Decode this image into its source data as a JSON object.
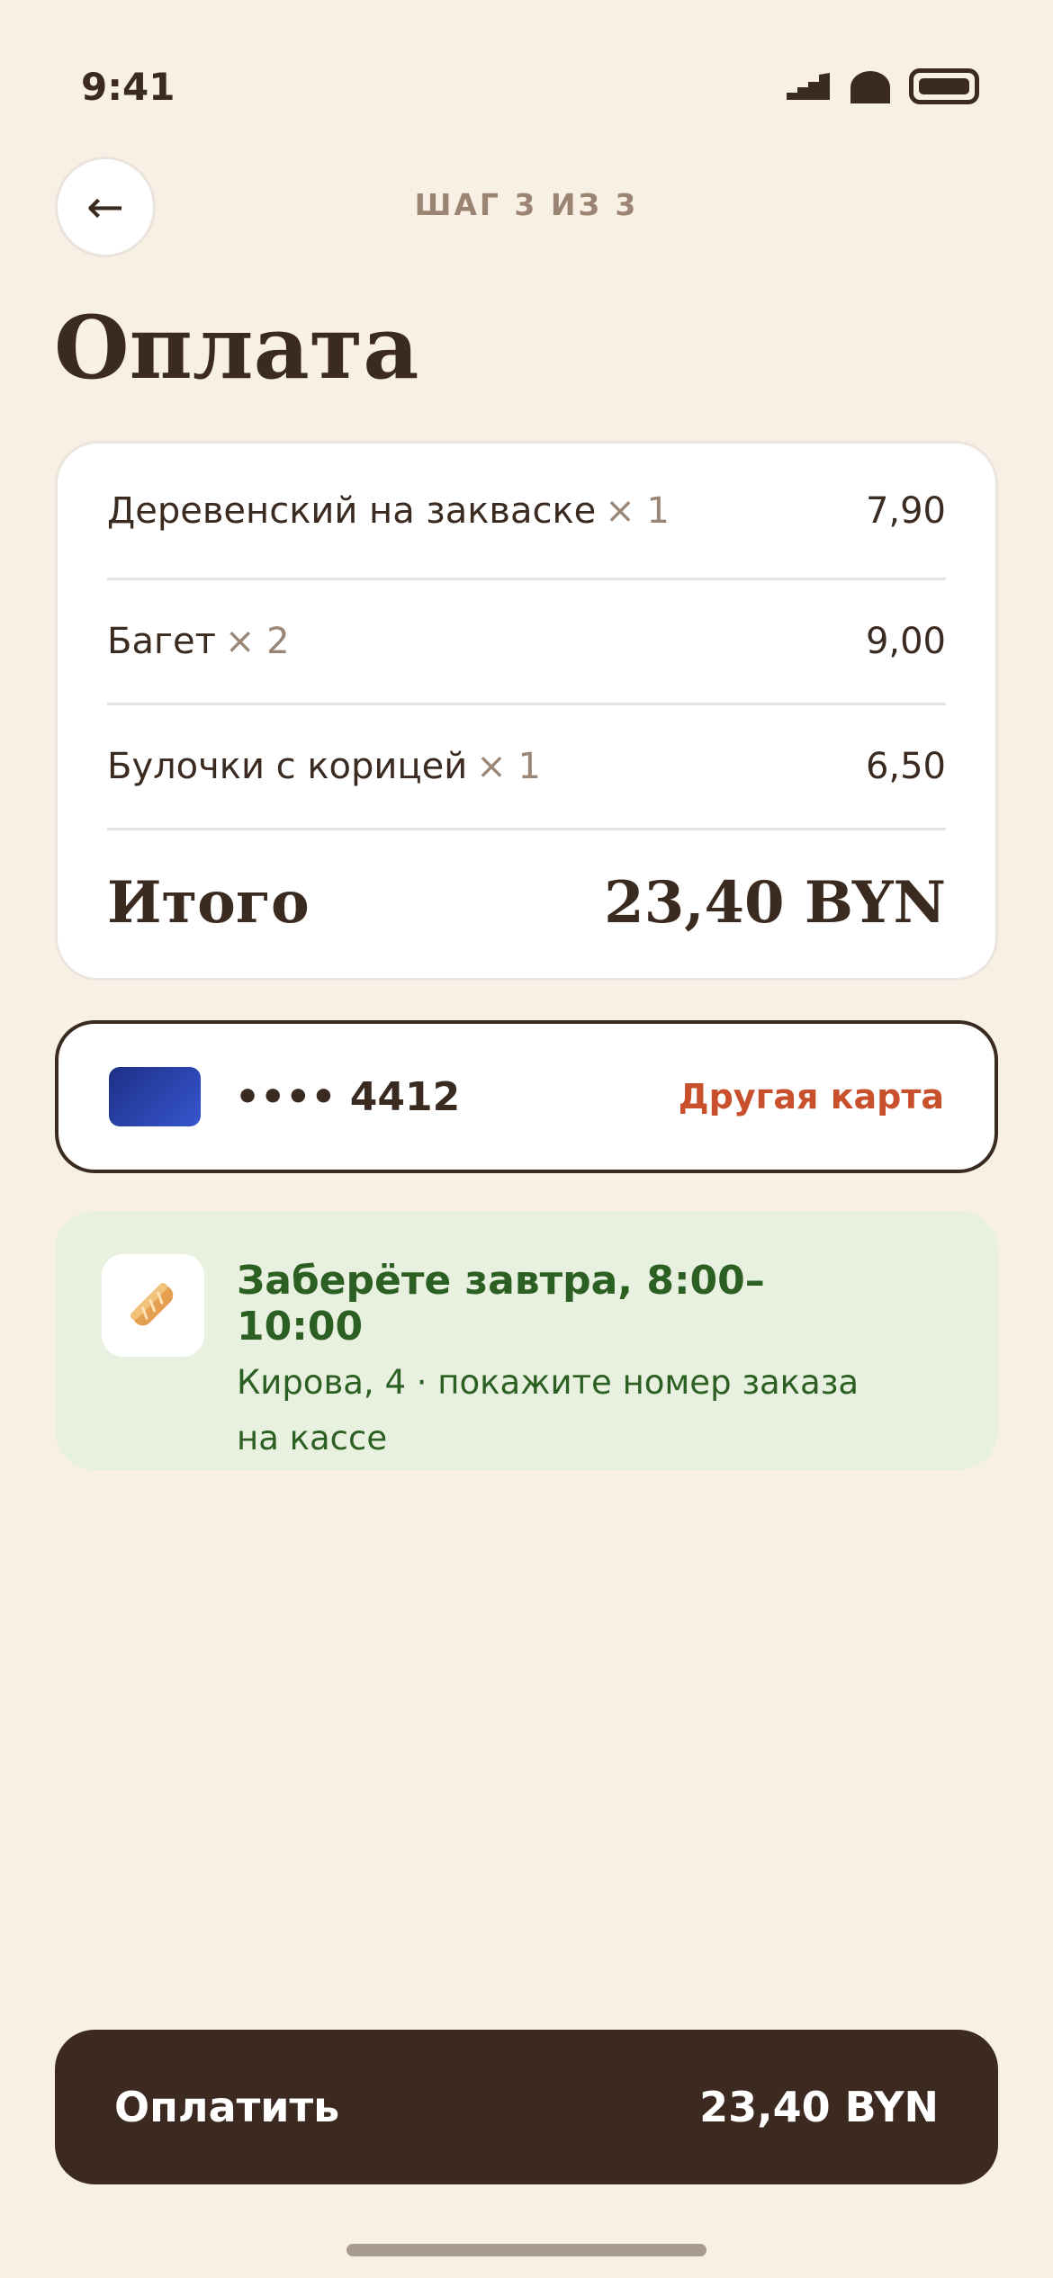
{
  "status_bar": {
    "time": "9:41"
  },
  "header": {
    "back_icon": "←",
    "step_label": "ШАГ 3 ИЗ 3"
  },
  "title": "Оплата",
  "order": {
    "items": [
      {
        "name": "Деревенский на закваске",
        "qty": "× 1",
        "price": "7,90"
      },
      {
        "name": "Багет",
        "qty": "× 2",
        "price": "9,00"
      },
      {
        "name": "Булочки с корицей",
        "qty": "× 1",
        "price": "6,50"
      }
    ],
    "total_label": "Итого",
    "total_value": "23,40 BYN"
  },
  "payment": {
    "card_mask": "•••• 4412",
    "other_card": "Другая карта",
    "card_color": "#2a44b0"
  },
  "pickup": {
    "icon": "🥖",
    "title": "Заберёте завтра, 8:00–10:00",
    "subtitle": "Кирова, 4 · покажите номер заказа на кассе"
  },
  "pay_button": {
    "label": "Оплатить",
    "amount": "23,40 BYN"
  }
}
